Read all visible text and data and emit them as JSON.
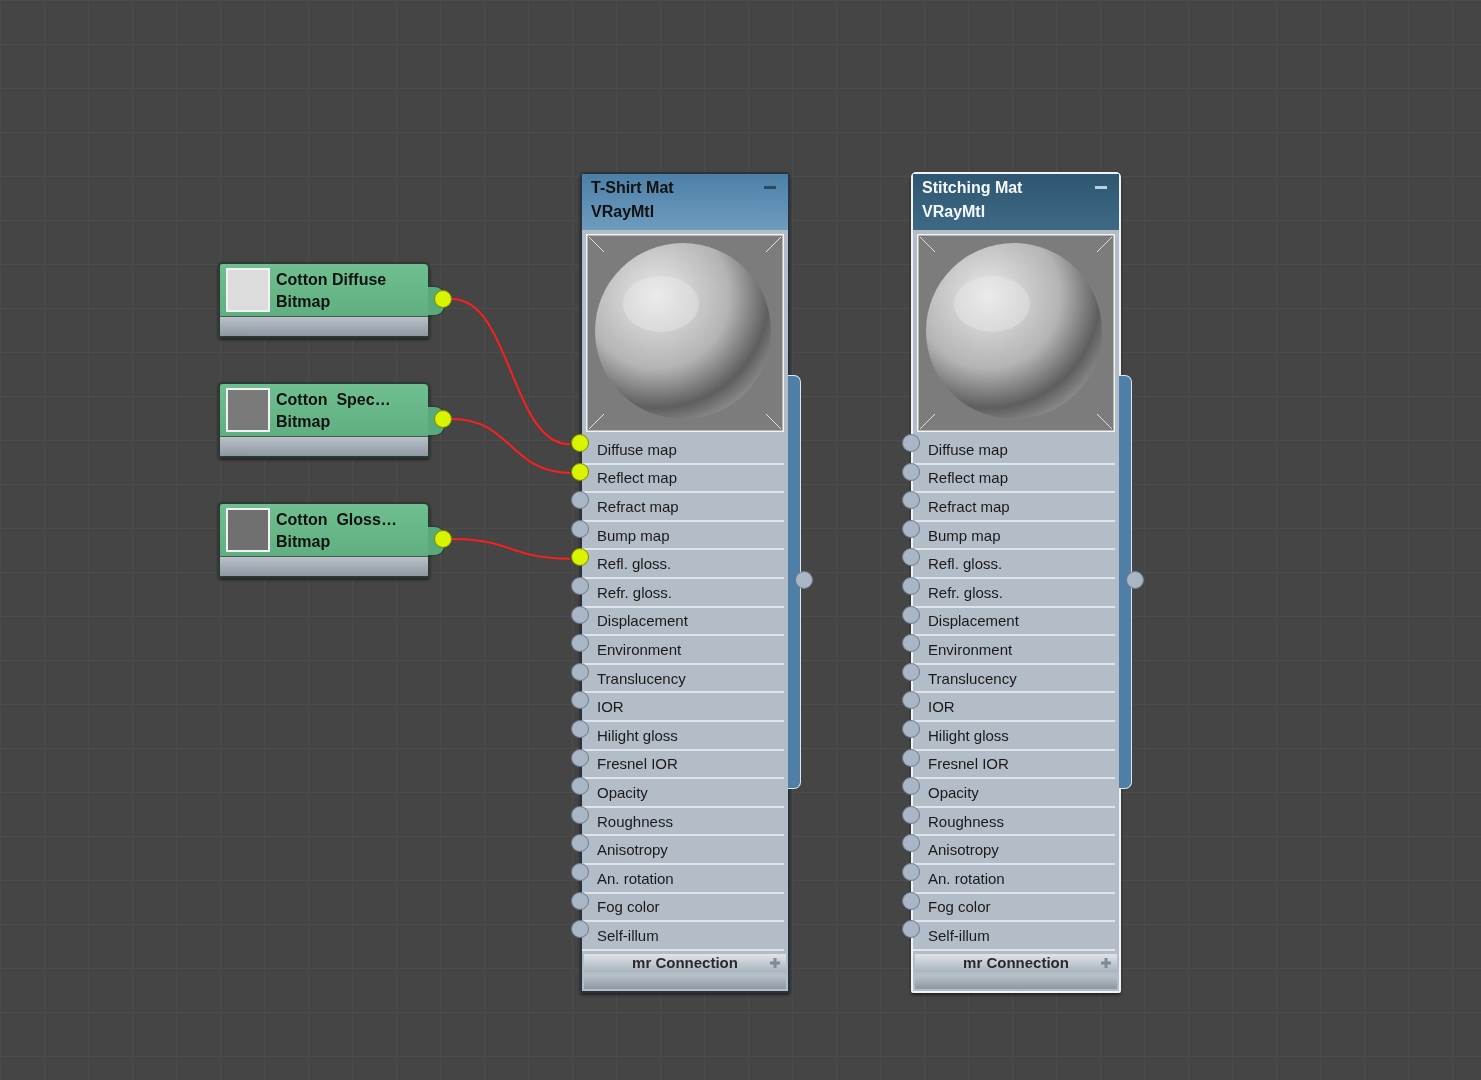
{
  "bitmaps": [
    {
      "title": "Cotton Diffuse",
      "type": "Bitmap",
      "color": "#dcdcdc",
      "connected": true
    },
    {
      "title": "Cotton  Spec…",
      "type": "Bitmap",
      "color": "#7a7a7a",
      "connected": true
    },
    {
      "title": "Cotton  Gloss…",
      "type": "Bitmap",
      "color": "#707070",
      "connected": true
    }
  ],
  "materials": [
    {
      "title": "T-Shirt Mat",
      "type": "VRayMtl",
      "selected": false,
      "footer": "mr Connection",
      "slots": [
        {
          "label": "Diffuse map",
          "connected": true
        },
        {
          "label": "Reflect map",
          "connected": true
        },
        {
          "label": "Refract map",
          "connected": false
        },
        {
          "label": "Bump map",
          "connected": false
        },
        {
          "label": "Refl. gloss.",
          "connected": true
        },
        {
          "label": "Refr. gloss.",
          "connected": false
        },
        {
          "label": "Displacement",
          "connected": false
        },
        {
          "label": "Environment",
          "connected": false
        },
        {
          "label": "Translucency",
          "connected": false
        },
        {
          "label": "IOR",
          "connected": false
        },
        {
          "label": "Hilight gloss",
          "connected": false
        },
        {
          "label": "Fresnel IOR",
          "connected": false
        },
        {
          "label": "Opacity",
          "connected": false
        },
        {
          "label": "Roughness",
          "connected": false
        },
        {
          "label": "Anisotropy",
          "connected": false
        },
        {
          "label": "An. rotation",
          "connected": false
        },
        {
          "label": "Fog color",
          "connected": false
        },
        {
          "label": "Self-illum",
          "connected": false
        }
      ]
    },
    {
      "title": "Stitching Mat",
      "type": "VRayMtl",
      "selected": true,
      "footer": "mr Connection",
      "slots": [
        {
          "label": "Diffuse map",
          "connected": false
        },
        {
          "label": "Reflect map",
          "connected": false
        },
        {
          "label": "Refract map",
          "connected": false
        },
        {
          "label": "Bump map",
          "connected": false
        },
        {
          "label": "Refl. gloss.",
          "connected": false
        },
        {
          "label": "Refr. gloss.",
          "connected": false
        },
        {
          "label": "Displacement",
          "connected": false
        },
        {
          "label": "Environment",
          "connected": false
        },
        {
          "label": "Translucency",
          "connected": false
        },
        {
          "label": "IOR",
          "connected": false
        },
        {
          "label": "Hilight gloss",
          "connected": false
        },
        {
          "label": "Fresnel IOR",
          "connected": false
        },
        {
          "label": "Opacity",
          "connected": false
        },
        {
          "label": "Roughness",
          "connected": false
        },
        {
          "label": "Anisotropy",
          "connected": false
        },
        {
          "label": "An. rotation",
          "connected": false
        },
        {
          "label": "Fog color",
          "connected": false
        },
        {
          "label": "Self-illum",
          "connected": false
        }
      ]
    }
  ]
}
